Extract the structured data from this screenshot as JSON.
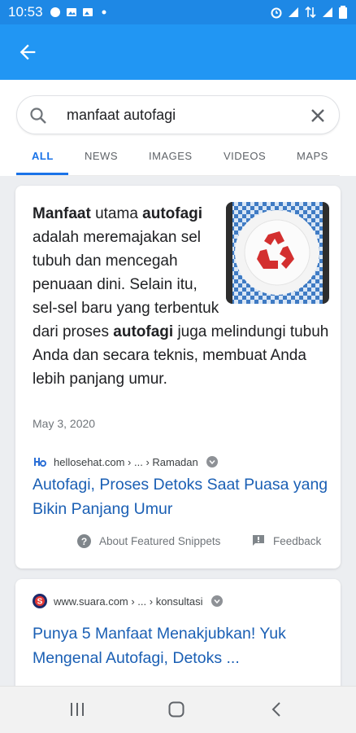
{
  "status": {
    "time": "10:53"
  },
  "search": {
    "query": "manfaat autofagi"
  },
  "tabs": [
    {
      "label": "ALL",
      "active": true
    },
    {
      "label": "NEWS",
      "active": false
    },
    {
      "label": "IMAGES",
      "active": false
    },
    {
      "label": "VIDEOS",
      "active": false
    },
    {
      "label": "MAPS",
      "active": false
    }
  ],
  "featured": {
    "s1": "Manfaat",
    "s2": " utama ",
    "s3": "autofagi",
    "s4": " adalah meremajakan sel tubuh dan mencegah penuaan dini. Selain itu, sel-sel baru yang terbentuk dari proses ",
    "s5": "autofagi",
    "s6": " juga melindungi tubuh Anda dan secara teknis, membuat Anda lebih panjang umur.",
    "date": "May 3, 2020",
    "source": "hellosehat.com › ... › Ramadan",
    "title": "Autofagi, Proses Detoks Saat Puasa yang Bikin Panjang Umur",
    "about_label": "About Featured Snippets",
    "feedback_label": "Feedback"
  },
  "result2": {
    "source": "www.suara.com › ... › konsultasi",
    "title": "Punya 5 Manfaat Menakjubkan! Yuk Mengenal Autofagi, Detoks ..."
  },
  "colors": {
    "appbar": "#2196f3",
    "statusbar": "#1e88e5",
    "link": "#1a5fb4",
    "tab_active": "#1a73e8"
  }
}
